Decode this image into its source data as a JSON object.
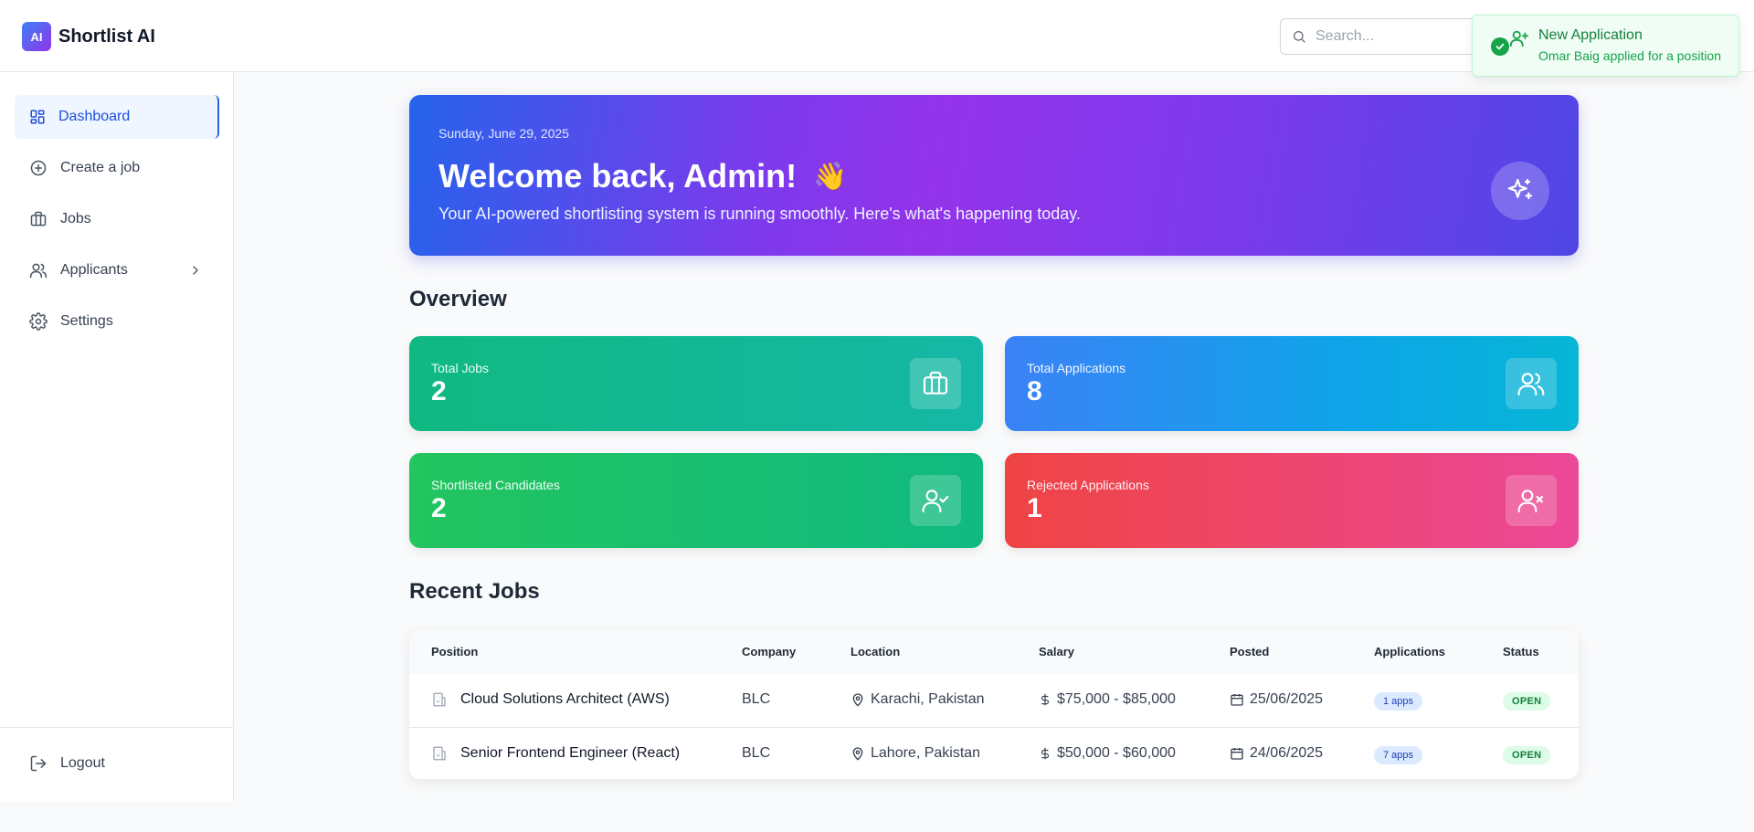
{
  "app": {
    "logo_badge": "AI",
    "name": "Shortlist AI"
  },
  "header": {
    "search_placeholder": "Search..."
  },
  "toast": {
    "title": "New Application",
    "message": "Omar Baig applied for a position"
  },
  "sidebar": {
    "items": [
      {
        "label": "Dashboard",
        "icon": "dashboard-icon"
      },
      {
        "label": "Create a job",
        "icon": "plus-circle-icon"
      },
      {
        "label": "Jobs",
        "icon": "briefcase-icon"
      },
      {
        "label": "Applicants",
        "icon": "users-icon"
      },
      {
        "label": "Settings",
        "icon": "gear-icon"
      }
    ],
    "logout_label": "Logout"
  },
  "banner": {
    "date": "Sunday, June 29, 2025",
    "title": "Welcome back, Admin!",
    "emoji": "👋",
    "subtitle": "Your AI-powered shortlisting system is running smoothly. Here's what's happening today."
  },
  "overview": {
    "title": "Overview",
    "cards": [
      {
        "label": "Total Jobs",
        "value": "2",
        "icon": "briefcase-icon"
      },
      {
        "label": "Total Applications",
        "value": "8",
        "icon": "users-icon"
      },
      {
        "label": "Shortlisted Candidates",
        "value": "2",
        "icon": "user-check-icon"
      },
      {
        "label": "Rejected Applications",
        "value": "1",
        "icon": "user-x-icon"
      }
    ]
  },
  "recent_jobs": {
    "title": "Recent Jobs",
    "columns": [
      "Position",
      "Company",
      "Location",
      "Salary",
      "Posted",
      "Applications",
      "Status"
    ],
    "rows": [
      {
        "position": "Cloud Solutions Architect (AWS)",
        "company": "BLC",
        "location": "Karachi, Pakistan",
        "salary": "$75,000 - $85,000",
        "posted": "25/06/2025",
        "applications": "1 apps",
        "status": "OPEN"
      },
      {
        "position": "Senior Frontend Engineer (React)",
        "company": "BLC",
        "location": "Lahore, Pakistan",
        "salary": "$50,000 - $60,000",
        "posted": "24/06/2025",
        "applications": "7 apps",
        "status": "OPEN"
      }
    ]
  },
  "colors": {
    "accent": "#2563eb",
    "success": "#16a34a",
    "danger": "#ef4444"
  }
}
